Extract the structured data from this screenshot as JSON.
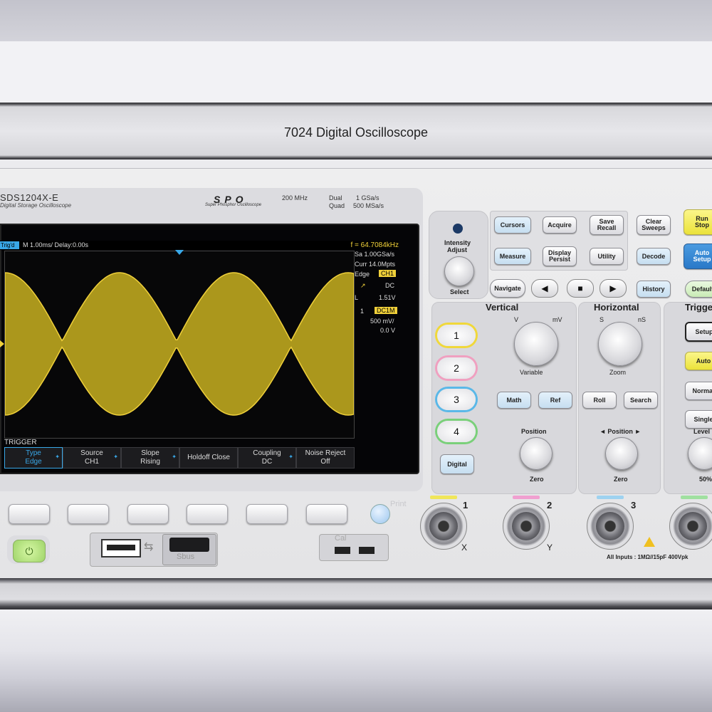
{
  "window": {
    "title": "7024 Digital Oscilloscope"
  },
  "brand": {
    "model": "SDS1204X-E",
    "subtitle": "Digital Storage Oscilloscope",
    "logo": "SPO",
    "logo_sub": "Super Phosphor Oscilloscope",
    "bandwidth": "200 MHz",
    "rate1_label": "Dual",
    "rate1_value": "1 GSa/s",
    "rate2_label": "Quad",
    "rate2_value": "500 MSa/s"
  },
  "display": {
    "trig_status": "Trig'd",
    "timebase": "M 1.00ms/ Delay:0.00s",
    "frequency": "f = 64.7084kHz",
    "sample_rate": "Sa 1.00GSa/s",
    "memory": "Curr 14.0Mpts",
    "trigger_type": "Edge",
    "trigger_source": "CH1",
    "trigger_coupling": "DC",
    "trigger_level_label": "L",
    "trigger_level": "1.51V",
    "channel_number": "1",
    "channel_coupling": "DC1M",
    "channel_scale": "500 mV/",
    "channel_offset": "0.0 V",
    "waveform_color": "#f0d03a",
    "menu_title": "TRIGGER",
    "softmenu": [
      {
        "top": "Type",
        "bottom": "Edge"
      },
      {
        "top": "Source",
        "bottom": "CH1"
      },
      {
        "top": "Slope",
        "bottom": "Rising"
      },
      {
        "top": "Holdoff Close",
        "bottom": ""
      },
      {
        "top": "Coupling",
        "bottom": "DC"
      },
      {
        "top": "Noise Reject",
        "bottom": "Off"
      }
    ]
  },
  "front": {
    "print_label": "Print",
    "sbus_label": "Sbus",
    "cal_label": "Cal",
    "power_icon": "power-icon"
  },
  "panel": {
    "intensity_label": "Intensity",
    "adjust_label": "Adjust",
    "select_label": "Select",
    "cursors": "Cursors",
    "acquire": "Acquire",
    "save": "Save",
    "recall": "Recall",
    "clear": "Clear",
    "sweeps": "Sweeps",
    "run": "Run",
    "stop": "Stop",
    "measure": "Measure",
    "display": "Display",
    "persist": "Persist",
    "utility": "Utility",
    "decode": "Decode",
    "auto": "Auto",
    "setup_word": "Setup",
    "navigate": "Navigate",
    "history": "History",
    "default": "Default",
    "prev": "◀",
    "stopnav": "■",
    "next": "▶",
    "vertical": "Vertical",
    "horizontal": "Horizontal",
    "trigger": "Trigger",
    "v": "V",
    "mv": "mV",
    "s": "S",
    "ns": "nS",
    "variable": "Variable",
    "zoom": "Zoom",
    "math": "Math",
    "ref": "Ref",
    "roll": "Roll",
    "search": "Search",
    "position": "Position",
    "hposition": "◄ Position ►",
    "zero": "Zero",
    "digital": "Digital",
    "ch1": "1",
    "ch2": "2",
    "ch3": "3",
    "ch4": "4",
    "trig_setup": "Setup",
    "trig_auto": "Auto",
    "trig_normal": "Normal",
    "trig_single": "Single",
    "level": "Level",
    "fifty": "50%",
    "bnc1": "1",
    "bnc2": "2",
    "bnc3": "3",
    "x": "X",
    "y": "Y",
    "inputs": "All Inputs : 1MΩ//15pF 400Vpk",
    "ch_colors": [
      "#f0e65a",
      "#f0a0d0",
      "#9ed2f0",
      "#a0e0a0"
    ]
  }
}
